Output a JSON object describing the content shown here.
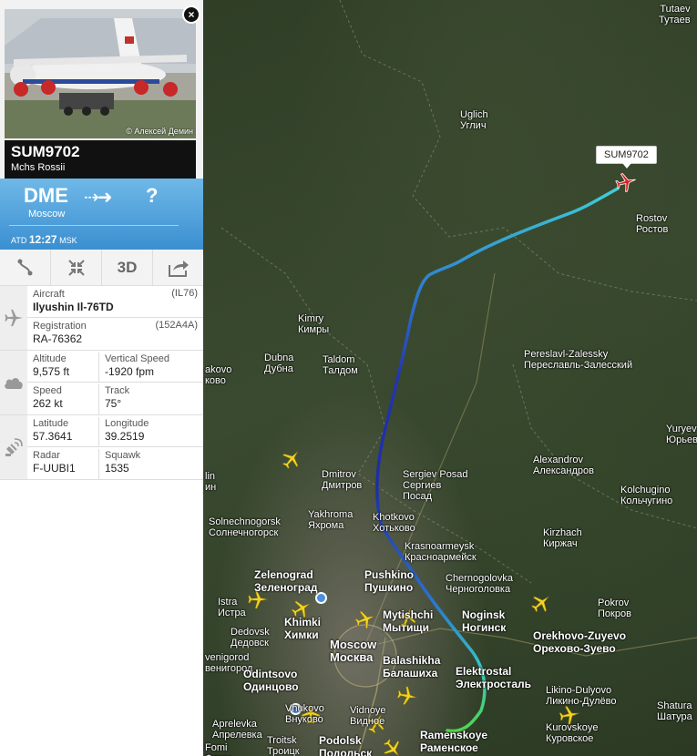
{
  "flight": {
    "callsign": "SUM9702",
    "airline": "Mchs Rossii",
    "photo_credit": "© Алексей Демин",
    "close_label": "×"
  },
  "route": {
    "origin_code": "DME",
    "origin_city": "Moscow",
    "arrow": "⇢➜",
    "dest_code": "?",
    "atd_label": "ATD",
    "atd_time": "12:27",
    "atd_tz": "MSK"
  },
  "toolbar": {
    "route_icon": "route-icon",
    "collapse_icon": "collapse-icon",
    "three_d_label": "3D",
    "share_icon": "share-icon"
  },
  "details": {
    "aircraft_label": "Aircraft",
    "aircraft_code": "(IL76)",
    "aircraft_value": "Ilyushin Il-76TD",
    "registration_label": "Registration",
    "registration_code": "(152A4A)",
    "registration_value": "RA-76362",
    "altitude_label": "Altitude",
    "altitude_value": "9,575 ft",
    "vspeed_label": "Vertical Speed",
    "vspeed_value": "-1920 fpm",
    "speed_label": "Speed",
    "speed_value": "262 kt",
    "track_label": "Track",
    "track_value": "75°",
    "lat_label": "Latitude",
    "lat_value": "57.3641",
    "lon_label": "Longitude",
    "lon_value": "39.2519",
    "radar_label": "Radar",
    "radar_value": "F-UUBI1",
    "squawk_label": "Squawk",
    "squawk_value": "1535"
  },
  "map": {
    "flight_tag": "SUM9702",
    "cities": [
      {
        "id": "tutaev",
        "name": "Tutaev\nТутаев"
      },
      {
        "id": "uglich",
        "name": "Uglich\nУглич"
      },
      {
        "id": "rostov",
        "name": "Rostov\nРостов"
      },
      {
        "id": "kimry",
        "name": "Kimry\nКимры"
      },
      {
        "id": "dubna",
        "name": "Dubna\nДубна"
      },
      {
        "id": "taldom",
        "name": "Taldom\nТалдом"
      },
      {
        "id": "akovo",
        "name": "akovo\nково"
      },
      {
        "id": "pereslavl",
        "name": "Pereslavl-Zalessky\nПереславль-Залесский"
      },
      {
        "id": "yuryev",
        "name": "Yuryev\nЮрьев-П"
      },
      {
        "id": "alexandrov",
        "name": "Alexandrov\nАлександров"
      },
      {
        "id": "dmitrov",
        "name": "Dmitrov\nДмитров"
      },
      {
        "id": "sergiev",
        "name": "Sergiev Posad\nСергиев\nПосад"
      },
      {
        "id": "kolchugino",
        "name": "Kolchugino\nКольчугино"
      },
      {
        "id": "lin",
        "name": "lin\nин"
      },
      {
        "id": "yakhroma",
        "name": "Yakhroma\nЯхрома"
      },
      {
        "id": "khotkovo",
        "name": "Khotkovo\nХотьково"
      },
      {
        "id": "solnech",
        "name": "Solnechnogorsk\nСолнечногорск"
      },
      {
        "id": "krasnoarm",
        "name": "Krasnoarmeysk\nКрасноармейск"
      },
      {
        "id": "kirzhach",
        "name": "Kirzhach\nКиржач"
      },
      {
        "id": "zelenograd",
        "name": "Zelenograd\nЗеленоград"
      },
      {
        "id": "pushkino",
        "name": "Pushkino\nПушкино"
      },
      {
        "id": "chernogol",
        "name": "Chernogolovka\nЧерноголовка"
      },
      {
        "id": "istra",
        "name": "Istra\nИстра"
      },
      {
        "id": "pokrov",
        "name": "Pokrov\nПокров"
      },
      {
        "id": "mytishchi",
        "name": "Mytishchi\nМытищи"
      },
      {
        "id": "noginsk",
        "name": "Noginsk\nНогинск"
      },
      {
        "id": "khimki",
        "name": "Khimki\nХимки"
      },
      {
        "id": "dedovsk",
        "name": "Dedovsk\nДедовск"
      },
      {
        "id": "orekhovo",
        "name": "Orekhovo-Zuyevo\nОрехово-Зуево"
      },
      {
        "id": "zvenigorod",
        "name": "venigorod\nвенигород"
      },
      {
        "id": "moscow",
        "name": "Moscow\nМосква"
      },
      {
        "id": "balashikha",
        "name": "Balashikha\nБалашиха"
      },
      {
        "id": "elektrostal",
        "name": "Elektrostal\nЭлектросталь"
      },
      {
        "id": "odintsovo",
        "name": "Odintsovo\nОдинцово"
      },
      {
        "id": "likino",
        "name": "Likino-Dulyovo\nЛикино-Дулёво"
      },
      {
        "id": "vnukovo",
        "name": "Vnukovo\nВнуково"
      },
      {
        "id": "vidnoye",
        "name": "Vidnoye\nВидное"
      },
      {
        "id": "aprelevka",
        "name": "Aprelevka\nАпрелевка"
      },
      {
        "id": "shatura",
        "name": "Shatura\nШатура"
      },
      {
        "id": "kurovskoye",
        "name": "Kurovskoye\nКуровское"
      },
      {
        "id": "ramenskoye",
        "name": "Ramenskoye\nРаменское"
      },
      {
        "id": "troitsk",
        "name": "Troitsk\nТроицк"
      },
      {
        "id": "podolsk",
        "name": "Podolsk\nПодольск"
      },
      {
        "id": "fominsk",
        "name": "Fomi\nФоми"
      }
    ]
  }
}
